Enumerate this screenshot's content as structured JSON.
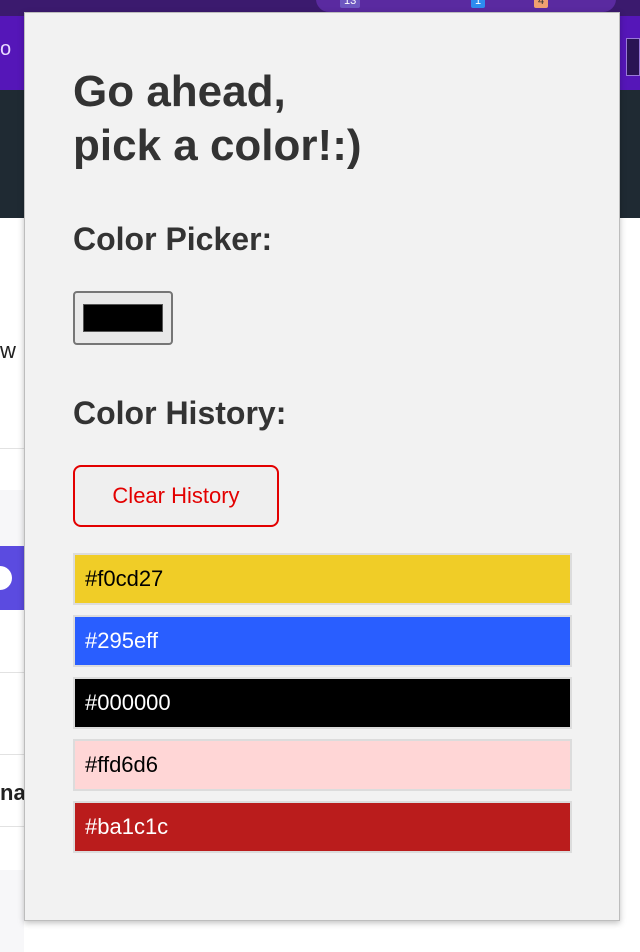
{
  "browser": {
    "tab_badges": [
      "13",
      "1",
      "4"
    ],
    "nav_fragment": "o",
    "content_fragments": [
      "w I",
      "na"
    ]
  },
  "popup": {
    "title_line1": "Go ahead,",
    "title_line2": "pick a color!:)",
    "picker_heading": "Color Picker:",
    "picker_value": "#000000",
    "history_heading": "Color History:",
    "clear_label": "Clear History",
    "history": [
      {
        "hex": "#f0cd27",
        "text_color": "#000000"
      },
      {
        "hex": "#295eff",
        "text_color": "#ffffff"
      },
      {
        "hex": "#000000",
        "text_color": "#ffffff"
      },
      {
        "hex": "#ffd6d6",
        "text_color": "#000000"
      },
      {
        "hex": "#ba1c1c",
        "text_color": "#ffffff"
      }
    ]
  },
  "colors": {
    "clear_button_accent": "#e30000",
    "popup_bg": "#f2f2f2",
    "heading_text": "#333333"
  }
}
